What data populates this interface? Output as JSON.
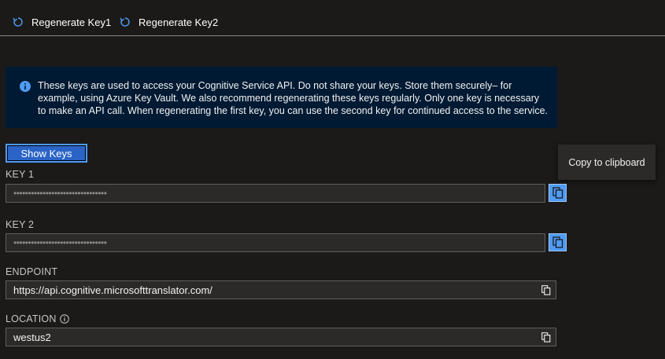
{
  "toolbar": {
    "regenerate_key1": "Regenerate Key1",
    "regenerate_key2": "Regenerate Key2"
  },
  "info_banner": {
    "text": "These keys are used to access your Cognitive Service API. Do not share your keys. Store them securely– for example, using Azure Key Vault. We also recommend regenerating these keys regularly. Only one key is necessary to make an API call. When regenerating the first key, you can use the second key for continued access to the service."
  },
  "show_keys_label": "Show Keys",
  "fields": {
    "key1": {
      "label": "KEY 1",
      "value": "••••••••••••••••••••••••••••••••"
    },
    "key2": {
      "label": "KEY 2",
      "value": "••••••••••••••••••••••••••••••••"
    },
    "endpoint": {
      "label": "ENDPOINT",
      "value": "https://api.cognitive.microsofttranslator.com/"
    },
    "location": {
      "label": "LOCATION",
      "value": "westus2"
    }
  },
  "tooltip": "Copy to clipboard",
  "colors": {
    "background": "#1b1a19",
    "accent": "#4f9bf5",
    "info_bg": "#001a33",
    "field_bg": "#2b2a29"
  },
  "icons": {
    "regenerate": "refresh-icon",
    "info": "info-icon",
    "copy": "copy-icon"
  }
}
